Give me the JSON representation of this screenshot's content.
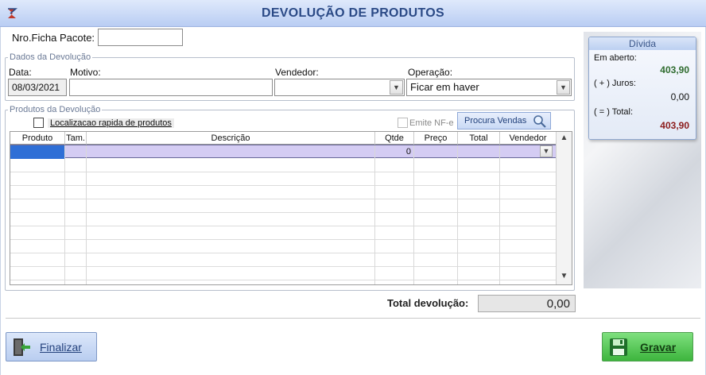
{
  "window": {
    "title": "DEVOLUÇÃO DE PRODUTOS"
  },
  "form": {
    "ficha_label": "Nro.Ficha Pacote:",
    "ficha_value": "",
    "dados_group": "Dados da Devolução",
    "data_label": "Data:",
    "data_value": "08/03/2021",
    "motivo_label": "Motivo:",
    "motivo_value": "",
    "vendedor_label": "Vendedor:",
    "vendedor_value": "",
    "operacao_label": "Operação:",
    "operacao_value": "Ficar em haver"
  },
  "produtos": {
    "group": "Produtos da Devolução",
    "quick_search_label": "Localizacao rapida de produtos",
    "emite_nfe_label": "Emite NF-e",
    "procura_vendas_label": "Procura Vendas",
    "columns": [
      "Produto",
      "Tam.",
      "Descrição",
      "Qtde",
      "Preço",
      "Total",
      "Vendedor"
    ],
    "rows": [
      {
        "produto": "",
        "tam": "",
        "descricao": "",
        "qtde": "0",
        "preco": "",
        "total": "",
        "vendedor": ""
      }
    ]
  },
  "divida": {
    "title": "Dívida",
    "em_aberto_label": "Em aberto:",
    "em_aberto_value": "403,90",
    "juros_label": "( + ) Juros:",
    "juros_value": "0,00",
    "total_label": "( = ) Total:",
    "total_value": "403,90",
    "colors": {
      "em_aberto": "#2e6b2e",
      "juros": "#111111",
      "total": "#8b1a1a"
    }
  },
  "totals": {
    "label": "Total devolução:",
    "value": "0,00"
  },
  "buttons": {
    "finalizar": "Finalizar",
    "gravar": "Gravar"
  },
  "icons": [
    "app-logo-icon",
    "chevron-down-icon",
    "magnifier-icon",
    "exit-door-icon",
    "floppy-disk-icon",
    "scroll-up-icon",
    "scroll-down-icon"
  ]
}
